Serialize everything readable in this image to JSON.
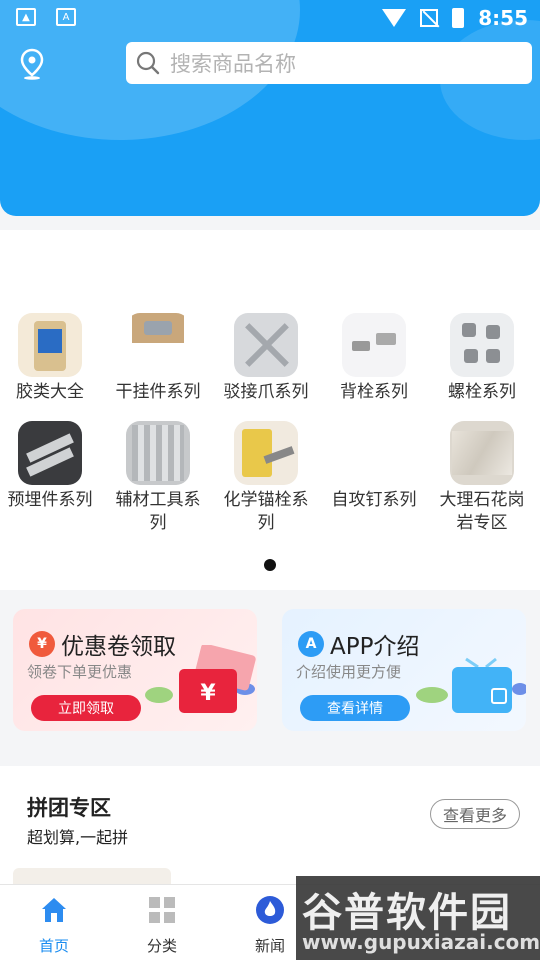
{
  "status_bar": {
    "time": "8:55"
  },
  "search": {
    "placeholder": "搜索商品名称"
  },
  "categories": [
    {
      "label": "胶类大全"
    },
    {
      "label": "干挂件系列"
    },
    {
      "label": "驳接爪系列"
    },
    {
      "label": "背栓系列"
    },
    {
      "label": "螺栓系列"
    },
    {
      "label": "预埋件系列"
    },
    {
      "label": "辅材工具系列"
    },
    {
      "label": "化学锚栓系列"
    },
    {
      "label": "自攻钉系列"
    },
    {
      "label": "大理石花岗岩专区"
    }
  ],
  "promo": {
    "coupon": {
      "title": "优惠卷领取",
      "subtitle": "领卷下单更优惠",
      "button": "立即领取",
      "icon": "¥"
    },
    "app": {
      "title": "APP介绍",
      "subtitle": "介绍使用更方便",
      "button": "查看详情",
      "icon": "A"
    }
  },
  "group_buy": {
    "title": "拼团专区",
    "subtitle": "超划算,一起拼",
    "more": "查看更多"
  },
  "tabbar": [
    {
      "label": "首页",
      "active": true
    },
    {
      "label": "分类",
      "active": false
    },
    {
      "label": "新闻",
      "active": false
    }
  ],
  "watermark": {
    "title": "谷普软件园",
    "url": "www.gupuxiazai.com"
  },
  "colors": {
    "primary": "#1aa0f5",
    "coupon_button": "#e8243d",
    "app_button": "#2d9cf5"
  }
}
